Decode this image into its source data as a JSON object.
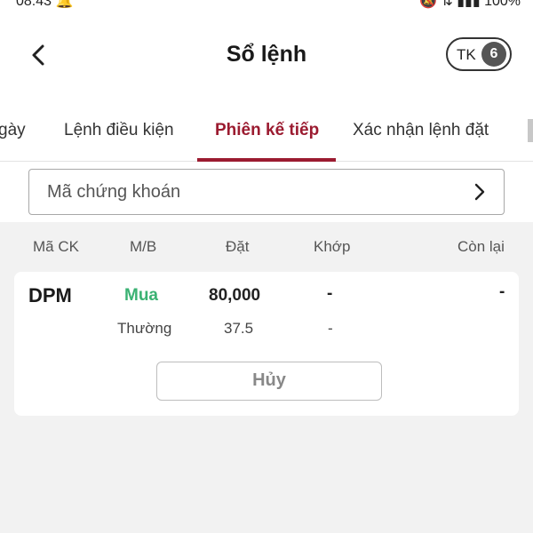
{
  "header": {
    "title": "Sổ lệnh",
    "account_label": "TK",
    "account_count": "6"
  },
  "tabs": [
    {
      "label": "gày",
      "active": false
    },
    {
      "label": "Lệnh điều kiện",
      "active": false
    },
    {
      "label": "Phiên kế tiếp",
      "active": true
    },
    {
      "label": "Xác nhận lệnh đặt",
      "active": false
    }
  ],
  "filter": {
    "stock_placeholder": "Mã chứng khoán"
  },
  "columns": {
    "symbol": "Mã CK",
    "side": "M/B",
    "placed": "Đặt",
    "matched": "Khớp",
    "remaining": "Còn lại"
  },
  "order": {
    "symbol": "DPM",
    "side": "Mua",
    "price": "80,000",
    "matched": "-",
    "remaining": "-",
    "order_type": "Thường",
    "quantity": "37.5",
    "matched_qty": "-",
    "cancel_label": "Hủy"
  },
  "colors": {
    "accent": "#9b1b30",
    "buy": "#3bb273",
    "background": "#f2f2f2"
  },
  "icons": {
    "back": "chevron-left-icon",
    "field": "chevron-right-icon"
  }
}
